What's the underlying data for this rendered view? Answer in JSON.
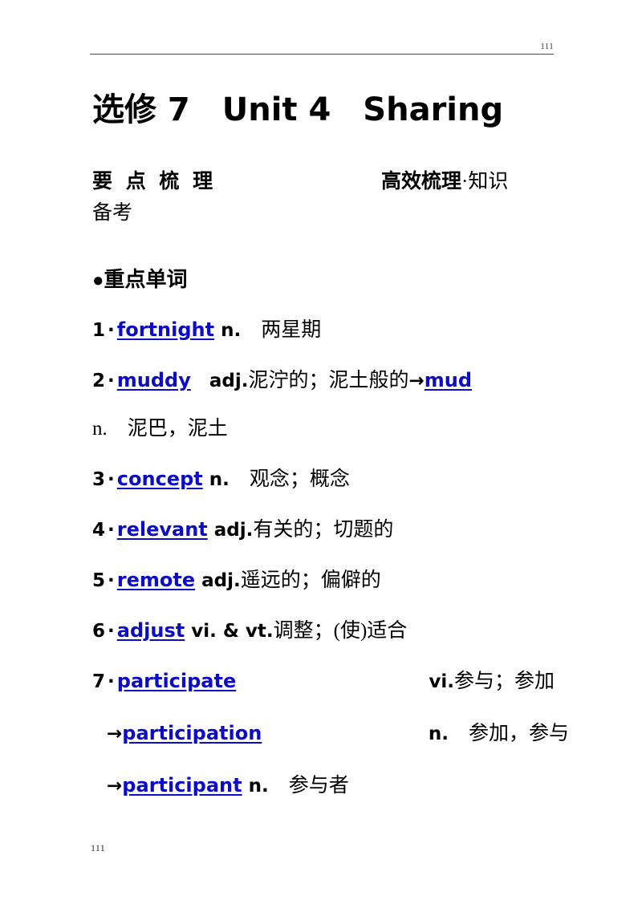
{
  "header": {
    "page_number": "111"
  },
  "title": {
    "text": "选修 7　Unit 4　Sharing"
  },
  "section": {
    "left_label": "要 点 梳 理",
    "right_bold": "高效梳理",
    "right_light": "·知识",
    "right_wrap": "备考"
  },
  "sub_heading": {
    "bullet": "●",
    "label": "重点单词"
  },
  "entries": [
    {
      "num": "1",
      "sep": "·",
      "word": "fortnight",
      "pos": " n.",
      "gloss": "　两星期",
      "layout": "inline"
    },
    {
      "num": "2",
      "sep": "·",
      "word": "muddy",
      "pos": "　adj.",
      "gloss": "泥泞的；泥土般的",
      "arrow": "→",
      "word2": "mud",
      "continuation": "n.　泥巴，泥土",
      "layout": "wrap"
    },
    {
      "num": "3",
      "sep": "·",
      "word": "concept",
      "pos": " n.",
      "gloss": "　观念；概念",
      "layout": "inline"
    },
    {
      "num": "4",
      "sep": "·",
      "word": "relevant",
      "pos": " adj.",
      "gloss": "有关的；切题的",
      "layout": "inline"
    },
    {
      "num": "5",
      "sep": "·",
      "word": "remote",
      "pos": " adj.",
      "gloss": "遥远的；偏僻的",
      "layout": "inline"
    },
    {
      "num": "6",
      "sep": "·",
      "word": "adjust",
      "pos": " vi. & vt.",
      "gloss": "调整；(使)适合",
      "layout": "inline"
    },
    {
      "num": "7",
      "sep": "·",
      "word": "participate",
      "pos": "vi.",
      "gloss": "参与；参加",
      "layout": "split"
    }
  ],
  "derivatives": [
    {
      "arrow": "→",
      "word": "participation",
      "pos": "n.",
      "gloss": "　参加，参与",
      "layout": "split"
    },
    {
      "arrow": "→",
      "word": "participant",
      "pos": " n.",
      "gloss": "　参与者",
      "layout": "inline"
    }
  ],
  "footer": {
    "page_number": "111"
  },
  "colors": {
    "link_blue": "#0c0cc8",
    "text_black": "#000000",
    "rule_gray": "#4a4a4a"
  }
}
